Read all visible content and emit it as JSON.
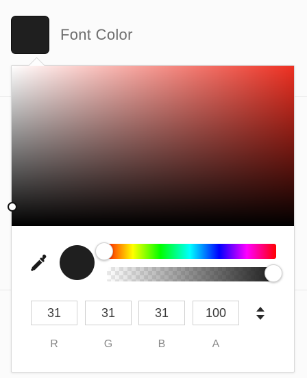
{
  "field": {
    "label": "Font Color"
  },
  "picker": {
    "hue_color": "#ee3022",
    "current_color": "#1f1f1f",
    "hue": 0,
    "saturation": 0,
    "brightness": 0.12,
    "alpha_percent": 100,
    "eyedropper_icon": "eyedropper-icon",
    "format_toggle_icon": "up-down-arrows-icon"
  },
  "channels": [
    {
      "label": "R",
      "value": "31"
    },
    {
      "label": "G",
      "value": "31"
    },
    {
      "label": "B",
      "value": "31"
    },
    {
      "label": "A",
      "value": "100"
    }
  ]
}
